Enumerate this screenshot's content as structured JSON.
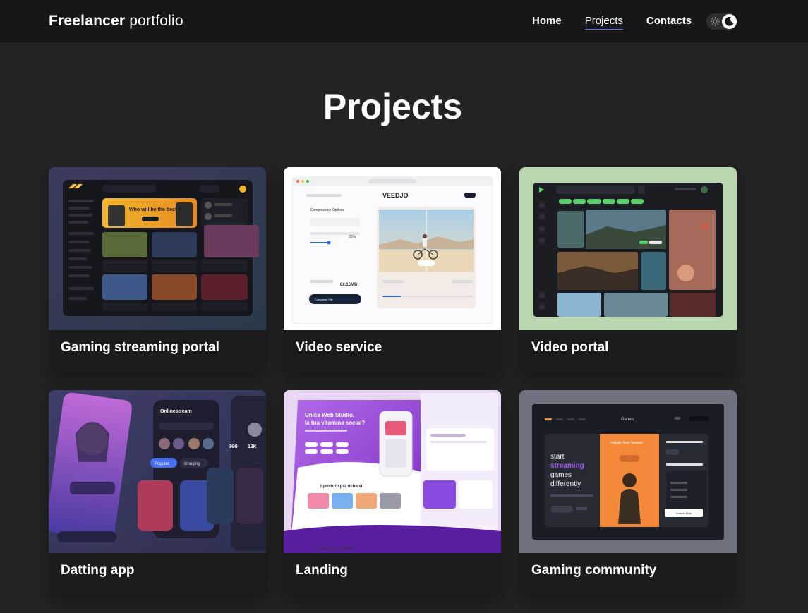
{
  "header": {
    "brand_bold": "Freelancer",
    "brand_light": "portfolio",
    "nav": [
      {
        "label": "Home"
      },
      {
        "label": "Projects"
      },
      {
        "label": "Contacts"
      }
    ],
    "theme_toggle": {
      "left_icon": "sun-icon",
      "right_icon": "moon-icon"
    }
  },
  "main": {
    "title": "Projects",
    "projects": [
      {
        "title": "Gaming streaming portal",
        "thumb_bg": "#3a3654"
      },
      {
        "title": "Video service",
        "thumb_bg": "#ffffff"
      },
      {
        "title": "Video portal",
        "thumb_bg": "#b9d6b0"
      },
      {
        "title": "Datting app",
        "thumb_bg": "#3b3b63"
      },
      {
        "title": "Landing",
        "thumb_bg": "#8a3fd4"
      },
      {
        "title": "Gaming community",
        "thumb_bg": "#6b6f80"
      }
    ],
    "thumb_texts": {
      "p1_banner": "Who will be the best ?",
      "p2_logo": "VEEDJO",
      "p2_panel": "Compression Options",
      "p2_size": "82.15MB",
      "p2_percent": "35%",
      "p2_button": "Compress File",
      "p4_app": "Onlinestream",
      "p4_btn1": "Popular",
      "p4_btn2": "Gonging",
      "p4_count1": "999",
      "p4_count2": "13K",
      "p5_heading1": "Unica Web Studio,",
      "p5_heading2": "la tua vitamina social?",
      "p5_sub": "I prodotti più richiesti",
      "p5_bottom": "I servizi più completi",
      "p6_logo": "Gamor",
      "p6_line1": "start",
      "p6_line2": "streaming",
      "p6_line3": "games",
      "p6_line4": "differently",
      "p6_card": "Fortnite New Season",
      "p6_btn": "Search Now"
    }
  }
}
